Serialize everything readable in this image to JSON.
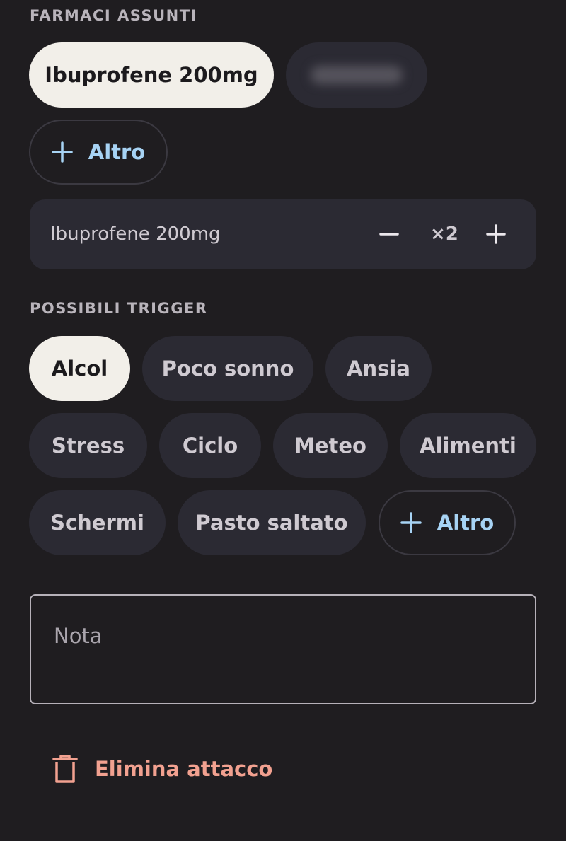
{
  "medications": {
    "section_label": "FARMACI ASSUNTI",
    "chips": [
      {
        "label": "Ibuprofene 200mg",
        "selected": true
      },
      {
        "label": "",
        "selected": false,
        "blurred": true
      }
    ],
    "add_label": "Altro",
    "dose": {
      "name": "Ibuprofene 200mg",
      "count": "×2",
      "decrement_icon": "minus-icon",
      "increment_icon": "plus-icon"
    }
  },
  "triggers": {
    "section_label": "POSSIBILI TRIGGER",
    "chips": [
      {
        "label": "Alcol",
        "selected": true
      },
      {
        "label": "Poco sonno",
        "selected": false
      },
      {
        "label": "Ansia",
        "selected": false
      },
      {
        "label": "Stress",
        "selected": false
      },
      {
        "label": "Ciclo",
        "selected": false
      },
      {
        "label": "Meteo",
        "selected": false
      },
      {
        "label": "Alimenti",
        "selected": false
      },
      {
        "label": "Schermi",
        "selected": false
      },
      {
        "label": "Pasto saltato",
        "selected": false
      }
    ],
    "add_label": "Altro"
  },
  "note": {
    "placeholder": "Nota",
    "value": ""
  },
  "delete": {
    "label": "Elimina attacco",
    "icon": "trash-icon"
  },
  "colors": {
    "background": "#1f1d20",
    "chip": "#2b2a33",
    "chip_selected": "#f2efe9",
    "accent_add": "#a7d3f4",
    "danger": "#f2a190"
  }
}
